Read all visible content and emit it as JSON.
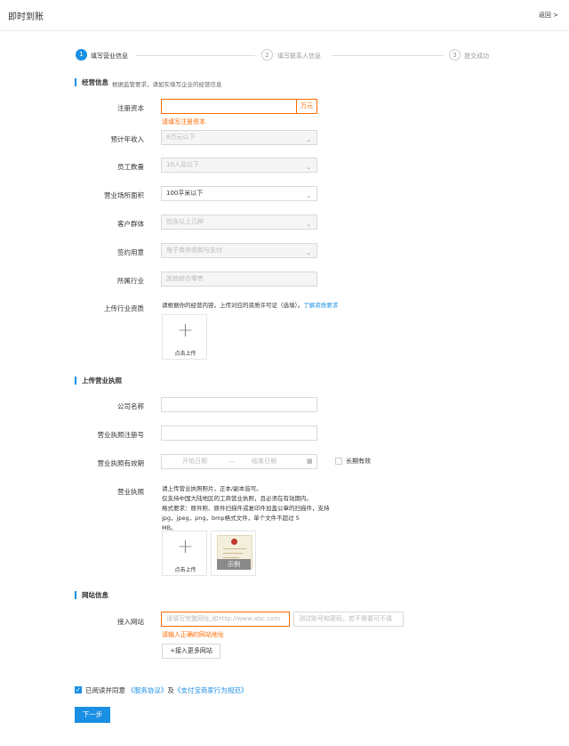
{
  "header": {
    "title": "即时到账",
    "back": "返回 >"
  },
  "steps": [
    {
      "num": "1",
      "label": "填写营业信息"
    },
    {
      "num": "2",
      "label": "填写联系人信息"
    },
    {
      "num": "3",
      "label": "提交成功"
    }
  ],
  "business": {
    "section_title": "经营信息",
    "section_hint": "根据监管要求，请如实填写企业的经营信息",
    "capital": {
      "label": "注册资本",
      "value": "",
      "unit": "万元",
      "error": "请填写注册资本"
    },
    "income": {
      "label": "预计年收入",
      "value": "8万元以下"
    },
    "employees": {
      "label": "员工数量",
      "value": "10人及以下"
    },
    "area": {
      "label": "营业场所面积",
      "value": "100平米以下"
    },
    "customers": {
      "label": "客户群体",
      "value": "包含以上几种"
    },
    "purpose": {
      "label": "签约用意",
      "value": "电子商务收款与支付"
    },
    "industry": {
      "label": "所属行业",
      "value": "其他综合零售"
    },
    "resources": {
      "label": "上传行业资质",
      "hint": "请根据你的经营内容，上传对应的资质许可证（选填）。",
      "link": "了解资质要求",
      "upload_label": "点击上传"
    }
  },
  "license": {
    "section_title": "上传营业执照",
    "company": {
      "label": "公司名称",
      "value": ""
    },
    "reg_no": {
      "label": "营业执照注册号",
      "value": ""
    },
    "validity": {
      "label": "营业执照有效期",
      "start": "开始日期",
      "sep": "—",
      "end": "结束日期",
      "long_term": "长期有效"
    },
    "photo": {
      "label": "营业执照",
      "hints": [
        "请上传营业执照照片，正本/副本皆可。",
        "仅支持中国大陆地区的工商营业执照，且必须在有效期内。",
        "格式要求：原件照、原件扫描件或复印件加盖公章的扫描件，支持jpg，jpeg，png，bmp格式文件，单个文件不超过 5",
        "MB。"
      ],
      "upload_label": "点击上传",
      "example_label": "示例"
    }
  },
  "website": {
    "section_title": "网站信息",
    "label": "接入网站",
    "url_placeholder": "请填写完整网址,如http://www.abc.com",
    "account_placeholder": "测试账号和密码，若不需要可不填",
    "error": "请输入正确的网站地址",
    "more_button": "+接入更多网站"
  },
  "agreement": {
    "prefix": "已阅读并同意",
    "service_link": "《服务协议》",
    "conj": "及",
    "rules_link": "《支付宝商家行为规范》",
    "checked": true
  },
  "next_button": "下一步",
  "colors": {
    "accent": "#1a8fe3",
    "error": "#ff6a00"
  }
}
